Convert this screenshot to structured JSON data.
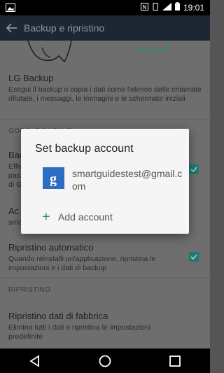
{
  "status": {
    "time": "19:01",
    "icons": [
      "image-icon",
      "nfc-icon",
      "vibrate-icon",
      "signal-icon",
      "battery-icon"
    ]
  },
  "appbar": {
    "title": "Backup e ripristino"
  },
  "settings": {
    "lg_backup": {
      "title": "LG Backup",
      "summary": "Esegui il backup o copia i dati come l'elenco delle chiamate rifiutate, i messaggi, le immagini e le schermate iniziali"
    },
    "google_section": "GOOGLE BACKUP",
    "backup_my_data": {
      "title": "Bac",
      "summary_lines": [
        "Effe",
        "pas",
        "di G"
      ]
    },
    "backup_account": {
      "title": "Ac",
      "summary": "sma"
    },
    "auto_restore": {
      "title": "Ripristino automatico",
      "summary": "Quando reinstalli un'applicazione, ripristina le impostazioni e i dati di backup"
    },
    "restore_section": "RIPRISTINO",
    "factory_reset": {
      "title": "Ripristino dati di fabbrica",
      "summary": "Elimina tutti i dati e ripristina le impostazioni predefinite"
    }
  },
  "dialog": {
    "title": "Set backup account",
    "account_email": "smartguidestest@gmail.com",
    "add_account": "Add account",
    "plus": "+"
  },
  "colors": {
    "accent": "#2a8c82",
    "appbar": "#1d2733",
    "account_icon": "#2b6cc4"
  }
}
